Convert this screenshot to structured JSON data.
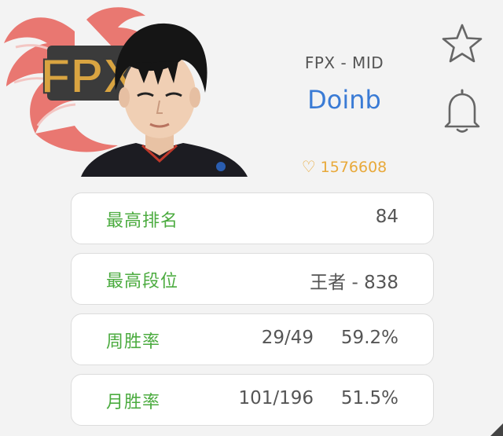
{
  "team_logo": {
    "text": "FPX",
    "icon": "phoenix-logo-icon",
    "wing_color": "#e7635f",
    "badge_color": "#c79b3c"
  },
  "player": {
    "team_position": "FPX - MID",
    "name": "Doinb",
    "likes_icon": "heart-outline-icon",
    "likes": "1576608",
    "portrait_icon": "player-portrait"
  },
  "actions": {
    "favorite_icon": "star-outline-icon",
    "notify_icon": "bell-outline-icon"
  },
  "stats": [
    {
      "label": "最高排名",
      "record": "",
      "value": "84"
    },
    {
      "label": "最高段位",
      "record": "",
      "value": "王者 - 838"
    },
    {
      "label": "周胜率",
      "record": "29/49",
      "value": "59.2%"
    },
    {
      "label": "月胜率",
      "record": "101/196",
      "value": "51.5%"
    }
  ],
  "colors": {
    "background": "#f3f3f3",
    "name": "#3a7bd5",
    "label_green": "#4bab3f",
    "likes_gold": "#e8a93a"
  }
}
